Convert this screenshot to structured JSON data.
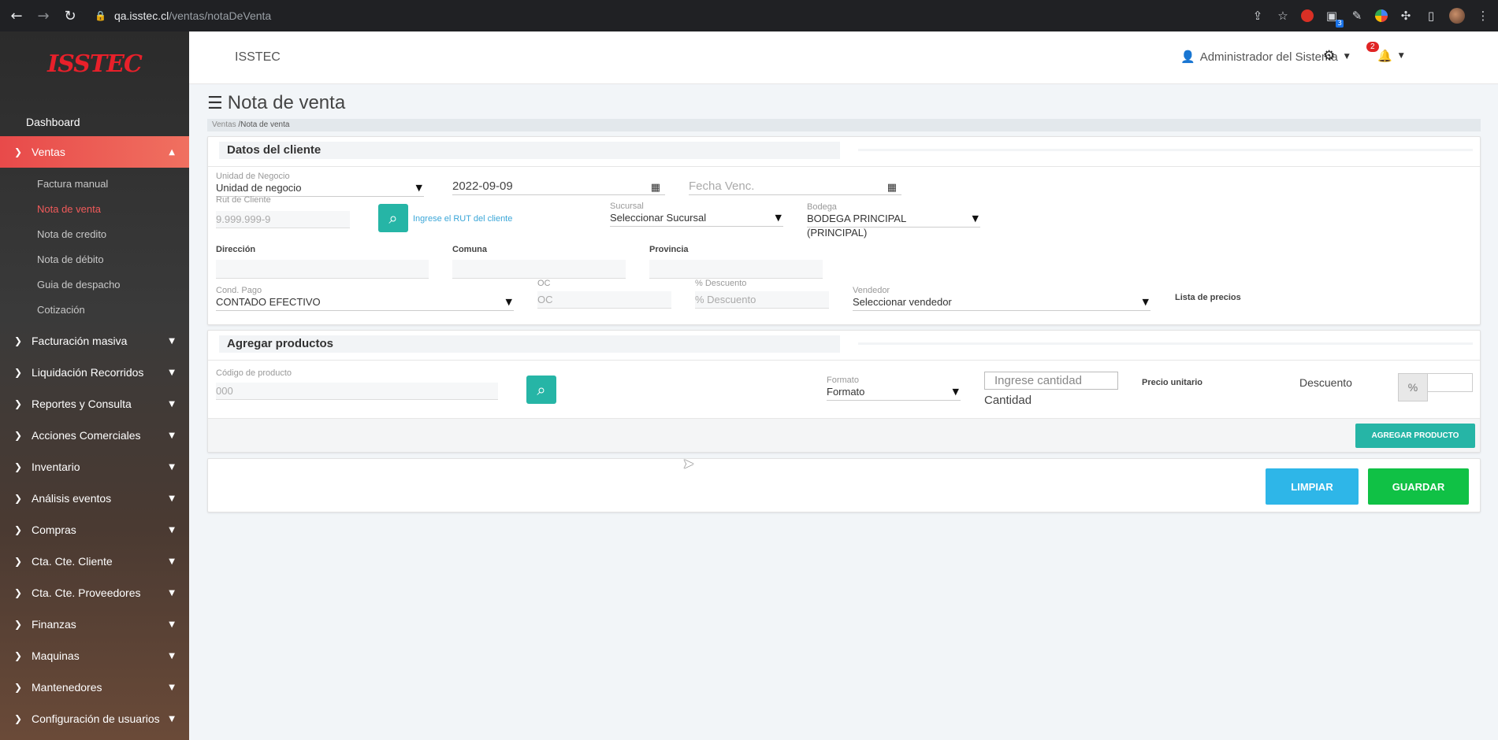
{
  "browser": {
    "url_host": "qa.isstec.cl",
    "url_path": "/ventas/notaDeVenta",
    "ext_badge": "3"
  },
  "sidebar": {
    "logo": "ISSTEC",
    "dashboard": "Dashboard",
    "active_section": "Ventas",
    "sub_items": [
      "Factura manual",
      "Nota de venta",
      "Nota de credito",
      "Nota de débito",
      "Guia de despacho",
      "Cotización"
    ],
    "sections": [
      "Facturación masiva",
      "Liquidación Recorridos",
      "Reportes y Consulta",
      "Acciones Comerciales",
      "Inventario",
      "Análisis eventos",
      "Compras",
      "Cta. Cte. Cliente",
      "Cta. Cte. Proveedores",
      "Finanzas",
      "Maquinas",
      "Mantenedores",
      "Configuración de usuarios"
    ]
  },
  "header": {
    "app_title": "ISSTEC",
    "user": "Administrador del Sistema",
    "notifications": "2"
  },
  "page": {
    "title": "Nota de venta",
    "breadcrumb_parent": "Ventas",
    "breadcrumb_current": "/Nota de venta"
  },
  "cliente": {
    "title": "Datos del cliente",
    "unidad_label": "Unidad de Negocio",
    "unidad_value": "Unidad de negocio",
    "fecha_value": "2022-09-09",
    "fecha_venc_placeholder": "Fecha Venc.",
    "rut_label": "Rut de Cliente",
    "rut_placeholder": "9.999.999-9",
    "rut_hint": "Ingrese el RUT del cliente",
    "sucursal_label": "Sucursal",
    "sucursal_value": "Seleccionar Sucursal",
    "bodega_label": "Bodega",
    "bodega_value": "BODEGA PRINCIPAL (PRINCIPAL)",
    "direccion_label": "Dirección",
    "comuna_label": "Comuna",
    "provincia_label": "Provincia",
    "cond_pago_label": "Cond. Pago",
    "cond_pago_value": "CONTADO EFECTIVO",
    "oc_label": "OC",
    "oc_placeholder": "OC",
    "descuento_label": "% Descuento",
    "descuento_placeholder": "% Descuento",
    "vendedor_label": "Vendedor",
    "vendedor_value": "Seleccionar vendedor",
    "lista_precios_label": "Lista de precios"
  },
  "productos": {
    "title": "Agregar productos",
    "codigo_label": "Código de producto",
    "codigo_placeholder": "000",
    "formato_label": "Formato",
    "formato_value": "Formato",
    "cantidad_placeholder": "Ingrese cantidad",
    "cantidad_label": "Cantidad",
    "precio_label": "Precio unitario",
    "descuento_label": "Descuento",
    "pct_symbol": "%",
    "add_button": "AGREGAR PRODUCTO"
  },
  "actions": {
    "limpiar": "LIMPIAR",
    "guardar": "GUARDAR"
  },
  "colors": {
    "accent_teal": "#26b5a6",
    "active_red": "#e84a4a",
    "limpiar_blue": "#2eb6e8",
    "guardar_green": "#10c145"
  }
}
